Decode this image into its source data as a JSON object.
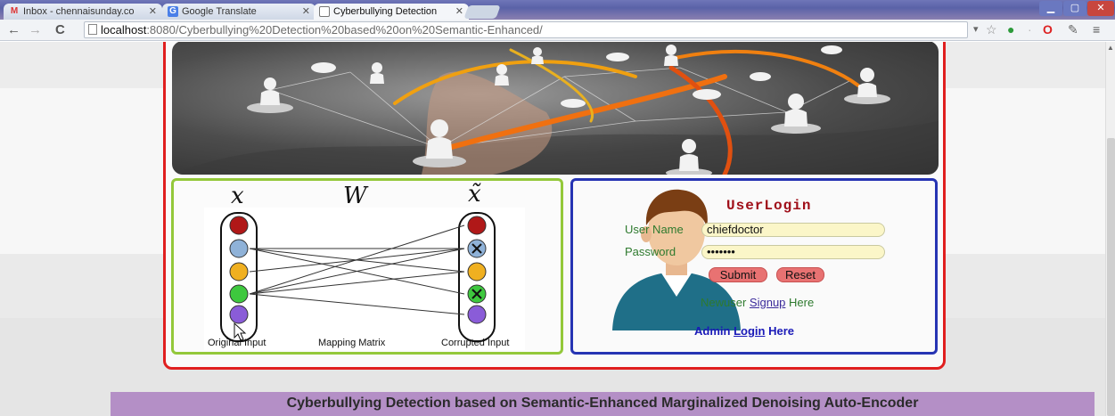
{
  "browser": {
    "tabs": [
      {
        "title": "Inbox - chennaisunday.co",
        "icon": "gmail-icon",
        "active": false
      },
      {
        "title": "Google Translate",
        "icon": "google-translate-icon",
        "active": false
      },
      {
        "title": "Cyberbullying Detection",
        "icon": "page-icon",
        "active": true
      }
    ],
    "url_host": "localhost",
    "url_rest": ":8080/Cyberbullying%20Detection%20based%20on%20Semantic-Enhanced/"
  },
  "diagram": {
    "symbols": {
      "x": "x",
      "w": "W",
      "x_tilde": "x̃"
    },
    "labels": {
      "original": "Original Input",
      "mapping": "Mapping Matrix",
      "corrupted": "Corrupted Input"
    },
    "node_colors": [
      "#b01818",
      "#8fb2d8",
      "#f0b020",
      "#3ec83e",
      "#8a5cd8"
    ]
  },
  "login": {
    "title": "UserLogin",
    "username_label": "User Name",
    "username_value": "chiefdoctor",
    "password_label": "Password",
    "password_value": "•••••••",
    "submit_label": "Submit",
    "reset_label": "Reset",
    "newuser_prefix": "Newuser",
    "signup_link": "Signup",
    "signup_suffix": "Here",
    "admin_prefix": "Admin",
    "admin_link": "Login",
    "admin_suffix": "Here"
  },
  "footer": {
    "title": "Cyberbullying Detection based on Semantic-Enhanced Marginalized Denoising Auto-Encoder"
  },
  "colors": {
    "frame_red": "#e01f1f",
    "panel_green": "#93c83a",
    "panel_blue": "#2634b3",
    "footer_purple": "#b48fc6"
  }
}
